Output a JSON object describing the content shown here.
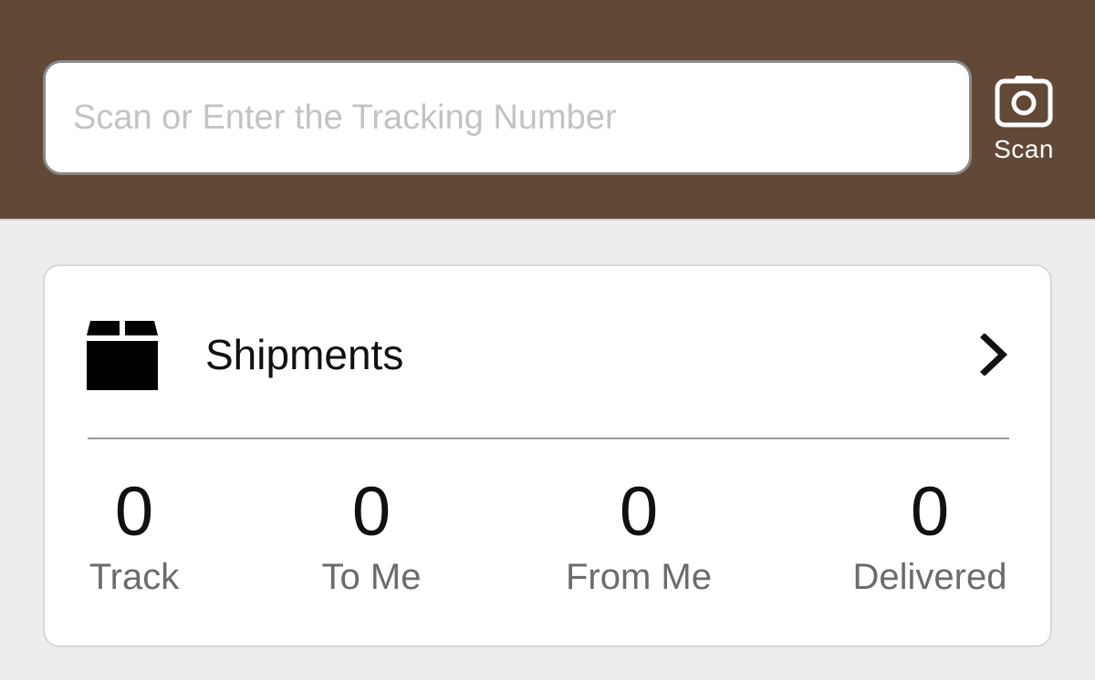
{
  "header": {
    "background_color": "#624837",
    "search": {
      "value": "",
      "placeholder": "Scan or Enter the Tracking Number"
    },
    "scan": {
      "icon": "camera-icon",
      "label": "Scan"
    }
  },
  "shipments_card": {
    "icon": "box-icon",
    "title": "Shipments",
    "chevron": "chevron-right-icon",
    "stats": [
      {
        "count": "0",
        "label": "Track"
      },
      {
        "count": "0",
        "label": "To Me"
      },
      {
        "count": "0",
        "label": "From Me"
      },
      {
        "count": "0",
        "label": "Delivered"
      }
    ]
  }
}
